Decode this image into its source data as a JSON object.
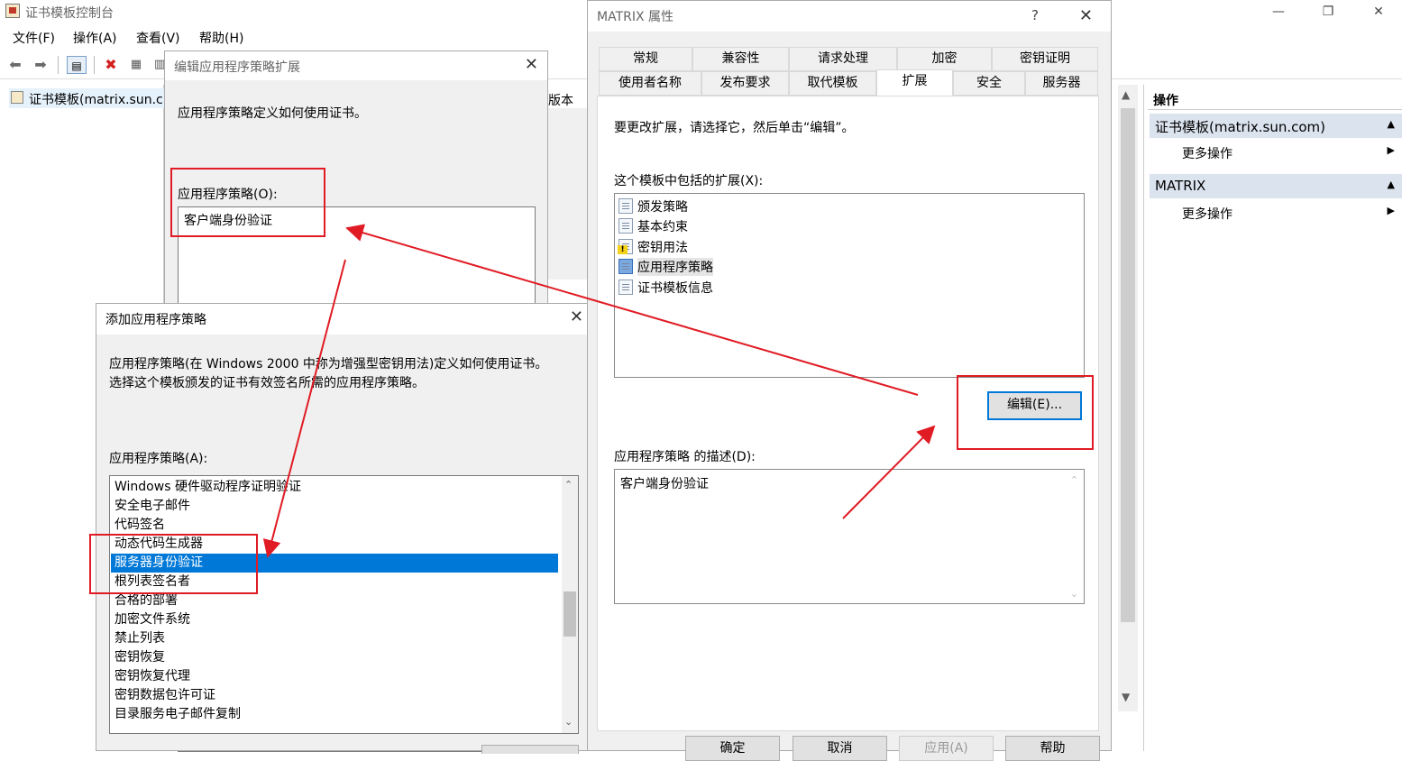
{
  "main_window": {
    "title": "证书模板控制台",
    "controls": {
      "minimize": "—",
      "restore": "❐",
      "close": "✕"
    },
    "menu": [
      "文件(F)",
      "操作(A)",
      "查看(V)",
      "帮助(H)"
    ],
    "tree_root": "证书模板(matrix.sun.c",
    "column_header_fragment": "版本"
  },
  "actions_pane": {
    "header": "操作",
    "groups": [
      {
        "label": "证书模板(matrix.sun.com)",
        "item": "更多操作"
      },
      {
        "label": "MATRIX",
        "item": "更多操作"
      }
    ],
    "collapse_glyph": "▲",
    "expand_glyph": "▶"
  },
  "edit_dialog": {
    "title": "编辑应用程序策略扩展",
    "close": "✕",
    "description": "应用程序策略定义如何使用证书。",
    "policies_label": "应用程序策略(O):",
    "policies": [
      "客户端身份验证"
    ]
  },
  "add_dialog": {
    "title": "添加应用程序策略",
    "close": "✕",
    "description_line1": "应用程序策略(在 Windows 2000 中称为增强型密钥用法)定义如何使用证书。",
    "description_line2": "选择这个模板颁发的证书有效签名所需的应用程序策略。",
    "list_label": "应用程序策略(A):",
    "items": [
      "Windows 硬件驱动程序证明验证",
      "安全电子邮件",
      "代码签名",
      "动态代码生成器",
      "服务器身份验证",
      "根列表签名者",
      "合格的部署",
      "加密文件系统",
      "禁止列表",
      "密钥恢复",
      "密钥恢复代理",
      "密钥数据包许可证",
      "目录服务电子邮件复制"
    ],
    "selected_index": 4,
    "scroll_up": "⌃",
    "scroll_down": "⌄"
  },
  "props_dialog": {
    "title": "MATRIX 属性",
    "help": "?",
    "close": "✕",
    "tabs_row1": [
      "常规",
      "兼容性",
      "请求处理",
      "加密",
      "密钥证明"
    ],
    "tabs_row2": [
      "使用者名称",
      "发布要求",
      "取代模板",
      "扩展",
      "安全",
      "服务器"
    ],
    "active_tab": "扩展",
    "instruction": "要更改扩展，请选择它，然后单击“编辑”。",
    "extensions_label": "这个模板中包括的扩展(X):",
    "extensions": [
      "颁发策略",
      "基本约束",
      "密钥用法",
      "应用程序策略",
      "证书模板信息"
    ],
    "selected_extension": "应用程序策略",
    "edit_button": "编辑(E)...",
    "description_label": "应用程序策略 的描述(D):",
    "description_value": "客户端身份验证",
    "buttons": [
      "确定",
      "取消",
      "应用(A)",
      "帮助"
    ]
  },
  "colors": {
    "annotation_red": "#e01b24",
    "selection_blue": "#0078d7",
    "dialog_gray": "#f0f0f0"
  }
}
